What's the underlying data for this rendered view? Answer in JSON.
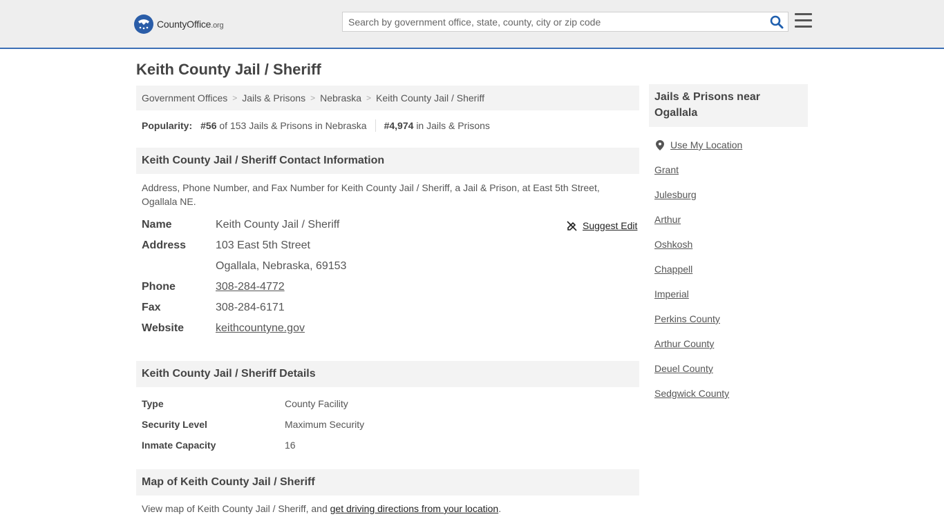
{
  "header": {
    "logo_text": "CountyOffice",
    "logo_suffix": ".org",
    "search_placeholder": "Search by government office, state, county, city or zip code"
  },
  "page_title": "Keith County Jail / Sheriff",
  "breadcrumb": [
    "Government Offices",
    "Jails & Prisons",
    "Nebraska",
    "Keith County Jail / Sheriff"
  ],
  "popularity": {
    "label": "Popularity:",
    "state_rank": "#56",
    "state_text": "of 153 Jails & Prisons in Nebraska",
    "national_rank": "#4,974",
    "national_text": "in Jails & Prisons"
  },
  "contact": {
    "heading": "Keith County Jail / Sheriff Contact Information",
    "description": "Address, Phone Number, and Fax Number for Keith County Jail / Sheriff, a Jail & Prison, at East 5th Street, Ogallala NE.",
    "suggest_edit": "Suggest Edit",
    "name_label": "Name",
    "name": "Keith County Jail / Sheriff",
    "address_label": "Address",
    "address_line1": "103 East 5th Street",
    "address_line2": "Ogallala, Nebraska, 69153",
    "phone_label": "Phone",
    "phone": "308-284-4772",
    "fax_label": "Fax",
    "fax": "308-284-6171",
    "website_label": "Website",
    "website": "keithcountyne.gov"
  },
  "details": {
    "heading": "Keith County Jail / Sheriff Details",
    "rows": [
      {
        "label": "Type",
        "value": "County Facility"
      },
      {
        "label": "Security Level",
        "value": "Maximum Security"
      },
      {
        "label": "Inmate Capacity",
        "value": "16"
      }
    ]
  },
  "map": {
    "heading": "Map of Keith County Jail / Sheriff",
    "text_before": "View map of Keith County Jail / Sheriff, and ",
    "link": "get driving directions from your location",
    "text_after": "."
  },
  "sidebar": {
    "heading": "Jails & Prisons near Ogallala",
    "use_location": "Use My Location",
    "links": [
      "Grant",
      "Julesburg",
      "Arthur",
      "Oshkosh",
      "Chappell",
      "Imperial",
      "Perkins County",
      "Arthur County",
      "Deuel County",
      "Sedgwick County"
    ]
  },
  "colors": {
    "accent_blue": "#3b6fb6",
    "logo_blue": "#2a5da8",
    "search_icon": "#1f5fae"
  }
}
